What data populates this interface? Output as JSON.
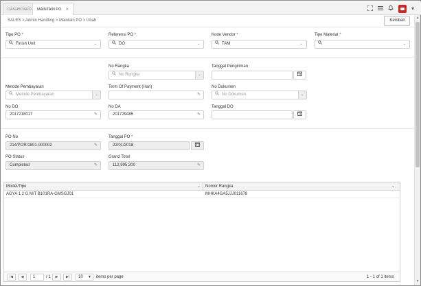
{
  "tabs": [
    {
      "label": "DASHBOARD"
    },
    {
      "label": "MAINTAIN PO",
      "close": "✕"
    }
  ],
  "topbar": {
    "menu_caret": "▾"
  },
  "breadcrumb": "SALES > Admin Handling > Maintain PO > Ubah",
  "kembali_label": "Kembali",
  "form": {
    "tipe_po": {
      "label": "Tipe PO",
      "value": "Finish Unit"
    },
    "referensi_po": {
      "label": "Referensi PO",
      "value": "DO"
    },
    "kode_vendor": {
      "label": "Kode Vendor",
      "value": "TAM"
    },
    "tipe_material": {
      "label": "Tipe Material",
      "value": ""
    },
    "no_rangka": {
      "label": "No Rangka",
      "placeholder": "No Rangka"
    },
    "tanggal_pengiriman": {
      "label": "Tanggal Pengiriman",
      "value": ""
    },
    "metode_pembayaran": {
      "label": "Metode Pembayaran",
      "placeholder": "Metode Pembayaran"
    },
    "term_of_payment": {
      "label": "Term Of Payment (Hari)",
      "value": ""
    },
    "no_dokumen": {
      "label": "No Dokumen",
      "placeholder": "No Dokumen"
    },
    "no_do": {
      "label": "No DO",
      "value": "2017218017"
    },
    "no_da": {
      "label": "No DA",
      "value": "201729485"
    },
    "tanggal_do": {
      "label": "Tanggal DO",
      "value": ""
    },
    "po_no": {
      "label": "PO No",
      "value": "214/POR/1801-000002"
    },
    "tanggal_po": {
      "label": "Tanggal PO",
      "value": "22/01/2018"
    },
    "po_status": {
      "label": "PO Status",
      "value": "Completed"
    },
    "grand_total": {
      "label": "Grand Total",
      "value": "112,995,200"
    },
    "required_mark": "*"
  },
  "grid": {
    "columns": [
      "Model/Tipe",
      "Nomor Rangka"
    ],
    "rows": [
      [
        "AGYA 1.2 G M/T B101RA-GMSGJ01",
        "MHKA4GA5JJJ011678"
      ]
    ],
    "pager": {
      "page": "1",
      "of_pages": "/ 1",
      "page_size": "10",
      "items_per_page": "items per page",
      "summary": "1 - 1 of 1 items"
    }
  },
  "icons": {
    "search": "🔍",
    "calendar": "📅",
    "pencil": "✎",
    "caret": "⌄"
  }
}
